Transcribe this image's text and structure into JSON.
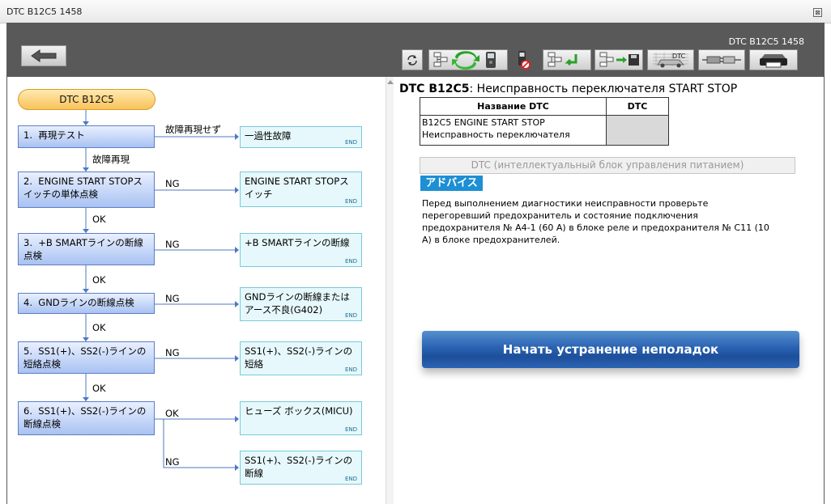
{
  "window": {
    "title": "DTC B12C5 1458",
    "close_symbol": "⊠"
  },
  "toolbar": {
    "dtc_code": "DTC B12C5 1458",
    "back_icon": "left-arrow-icon",
    "buttons": [
      "refresh-icon",
      "diagram-refresh-icon",
      "diagnostic-tester-icon",
      "no-phone-icon",
      "diagram-return-icon",
      "diagram-save-icon",
      "dtc-car-icon",
      "connector-icon",
      "printer-icon"
    ],
    "dtc_button_label": "DTC"
  },
  "flowchart": {
    "start": "DTC B12C5",
    "steps": [
      {
        "num": "1.",
        "text": "再現テスト"
      },
      {
        "num": "2.",
        "text": "ENGINE START STOPスイッチの単体点検"
      },
      {
        "num": "3.",
        "text": "+B SMARTラインの断線点検"
      },
      {
        "num": "4.",
        "text": "GNDラインの断線点検"
      },
      {
        "num": "5.",
        "text": "SS1(+)、SS2(-)ラインの短絡点検"
      },
      {
        "num": "6.",
        "text": "SS1(+)、SS2(-)ラインの断線点検"
      }
    ],
    "results": [
      {
        "text": "一過性故障"
      },
      {
        "text": "ENGINE START STOPスイッチ"
      },
      {
        "text": "+B SMARTラインの断線"
      },
      {
        "text": "GNDラインの断線またはアース不良(G402)"
      },
      {
        "text": "SS1(+)、SS2(-)ラインの短絡"
      },
      {
        "text": "ヒューズ ボックス(MICU)"
      },
      {
        "text": "SS1(+)、SS2(-)ラインの断線"
      }
    ],
    "end_label": "END",
    "branch_labels": {
      "not_reproduced": "故障再現せず",
      "reproduced": "故障再現",
      "ng": "NG",
      "ok": "OK"
    }
  },
  "detail": {
    "title_code": "DTC B12C5",
    "title_rest": ": Неисправность переключателя START STOP",
    "table": {
      "headers": [
        "Название DTC",
        "DTC"
      ],
      "rows": [
        {
          "name_line1": "B12C5 ENGINE START STOP",
          "name_line2": "Неисправность переключателя",
          "dtc": ""
        }
      ]
    },
    "ecu_bar": "DTC (интеллектуальный блок управления питанием)",
    "advice_label": "アドバイス",
    "advice_text": "Перед выполнением диагностики неисправности проверьте перегоревший предохранитель и состояние подключения предохранителя № А4-1 (60 А) в блоке реле и предохранителя № С11 (10 А) в блоке предохранителей.",
    "start_button": "Начать устранение неполадок"
  }
}
